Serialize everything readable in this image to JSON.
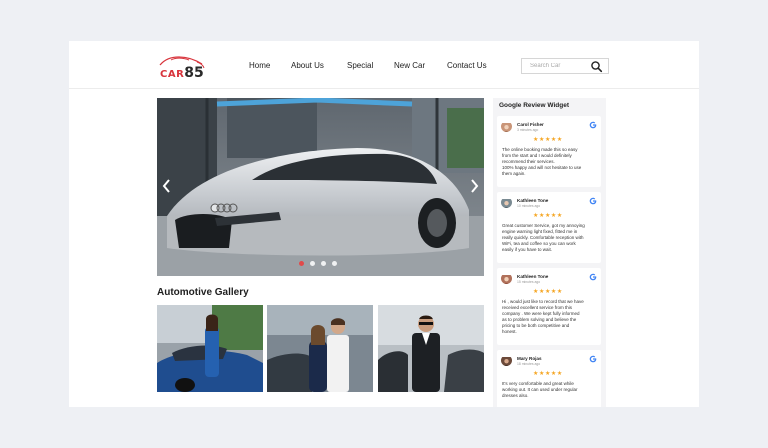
{
  "brand": {
    "logo_prefix": "CAR",
    "logo_number": "85",
    "accent": "#d8343c"
  },
  "nav": {
    "items": [
      "Home",
      "About Us",
      "Special",
      "New Car",
      "Contact Us"
    ]
  },
  "search": {
    "placeholder": "Search Car",
    "icon": "search-icon"
  },
  "slider": {
    "slide_count": 4,
    "active_slide": 1
  },
  "gallery": {
    "title": "Automotive Gallery",
    "images": [
      "woman-blue-car",
      "couple-car",
      "businessman-car"
    ]
  },
  "widget": {
    "title": "Google Review Widget",
    "reviews": [
      {
        "name": "Carol Fisher",
        "time": "3 minutes ago",
        "stars": "★★★★★",
        "lines": [
          "The online booking made this so easy",
          "from the start and I would definitely",
          "recommend their services.",
          "100% happy and will not hesitate to use",
          "them again."
        ]
      },
      {
        "name": "Kathleen Tone",
        "time": "10 minutes ago",
        "stars": "★★★★★",
        "lines": [
          "Great customer Service, got my annoying",
          "engine warning light fixed, fitted me in",
          "really quickly. Comfortable reception with",
          "WiFi, tea and coffee so you can work",
          "easily if you have to wait."
        ]
      },
      {
        "name": "Kathleen Tone",
        "time": "15 minutes ago",
        "stars": "★★★★★",
        "lines": [
          "Hi , would just like to record that we have",
          "received excellent service from this",
          "company . We were kept fully informed",
          "as to problem solving and believe the",
          "pricing to be both competitive and",
          "honest."
        ]
      },
      {
        "name": "Mary Rojas",
        "time": "18 minutes ago",
        "stars": "★★★★★",
        "lines": [
          "It's very comfortable and great while",
          "working out. It can used under regular",
          "dresses also."
        ]
      }
    ]
  },
  "colors": {
    "star": "#f5a623",
    "active_dot": "#e14a4a"
  }
}
